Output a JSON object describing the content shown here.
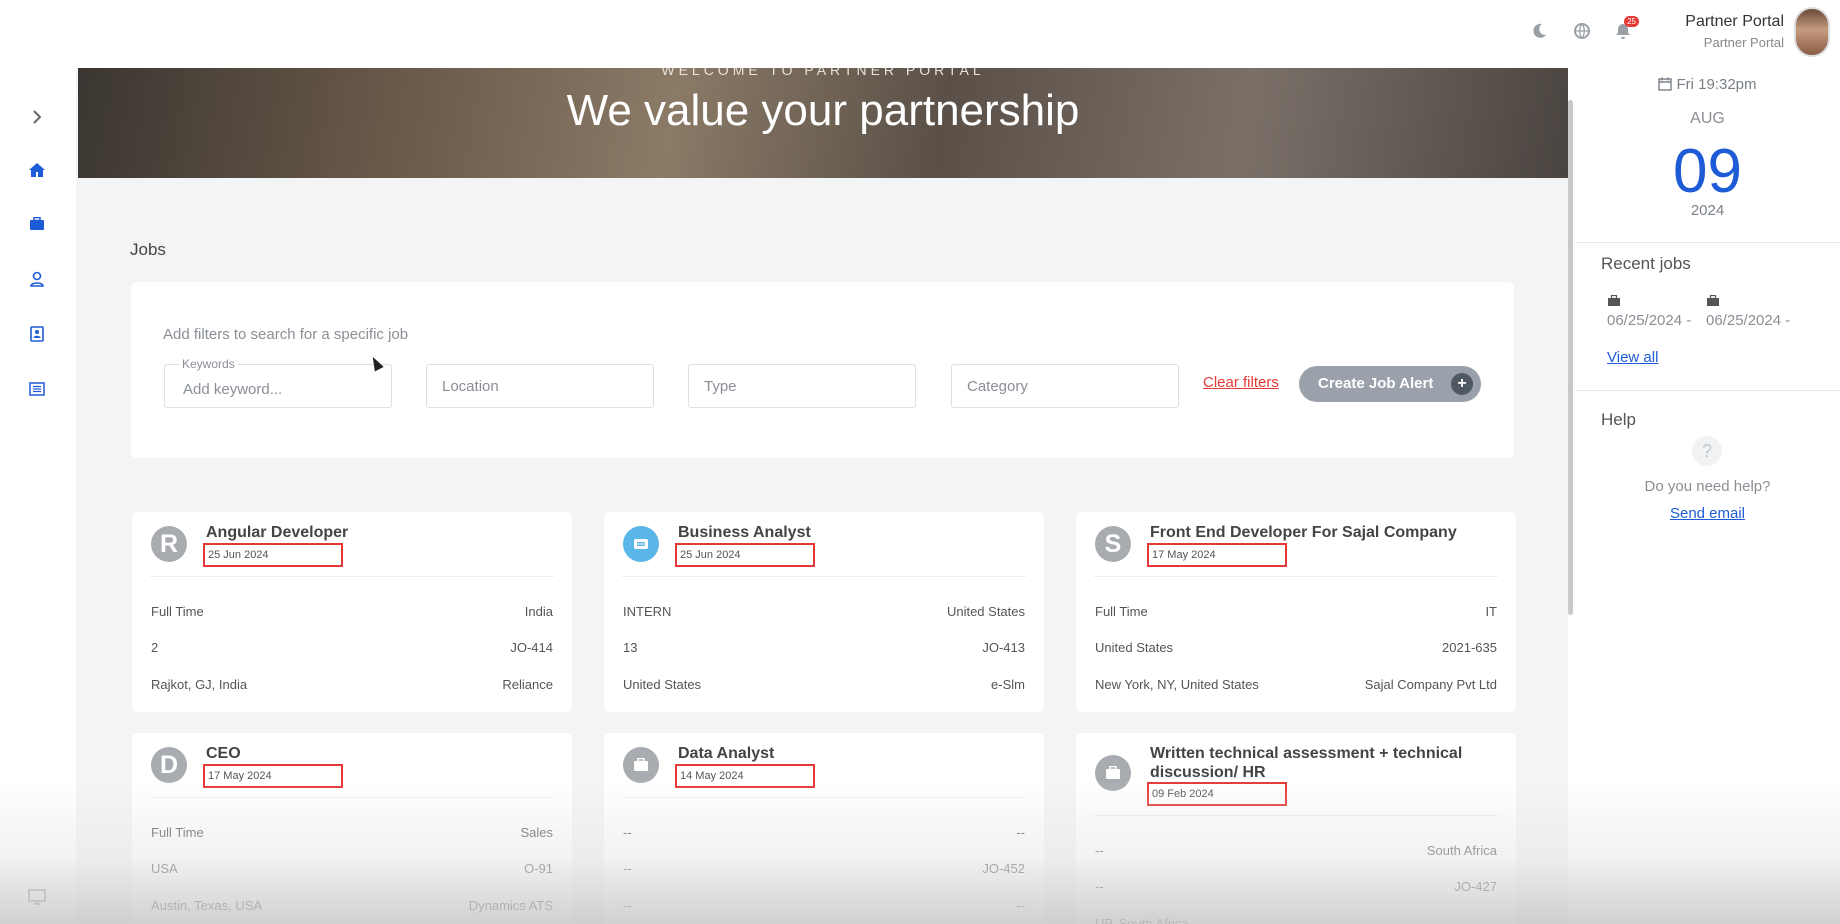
{
  "topbar": {
    "ghost_text": "",
    "notification_count": "25",
    "user_name": "Partner Portal",
    "user_role": "Partner Portal",
    "icons": [
      "moon-icon",
      "globe-icon",
      "bell-icon"
    ]
  },
  "sidebar": {
    "items": [
      "expand-chevron-icon",
      "home-icon",
      "briefcase-icon",
      "user-icon",
      "contacts-icon",
      "list-icon",
      "screen-share-icon"
    ]
  },
  "hero": {
    "subtitle": "WELCOME TO PARTNER PORTAL",
    "title": "We value your partnership"
  },
  "jobs": {
    "section_title": "Jobs",
    "filter_hint": "Add filters to search for a specific job",
    "keywords_label": "Keywords",
    "keywords_placeholder": "Add keyword...",
    "location_placeholder": "Location",
    "type_placeholder": "Type",
    "category_placeholder": "Category",
    "clear_filters": "Clear filters",
    "create_alert": "Create Job Alert",
    "create_alert_plus": "+"
  },
  "job_cards": [
    {
      "logo": "R",
      "title": "Angular Developer",
      "date": "25 Jun 2024",
      "rows": [
        [
          "Full Time",
          "India"
        ],
        [
          "2",
          "JO-414"
        ],
        [
          "Rajkot, GJ, India",
          "Reliance"
        ]
      ]
    },
    {
      "logo": "",
      "title": "Business Analyst",
      "date": "25 Jun 2024",
      "rows": [
        [
          "INTERN",
          "United States"
        ],
        [
          "13",
          "JO-413"
        ],
        [
          "United States",
          "e-Slm"
        ]
      ]
    },
    {
      "logo": "S",
      "title": "Front End Developer For Sajal Company",
      "date": "17 May 2024",
      "rows": [
        [
          "Full Time",
          "IT"
        ],
        [
          "United States",
          "2021-635"
        ],
        [
          "New York, NY, United States",
          "Sajal Company Pvt Ltd"
        ]
      ]
    },
    {
      "logo": "D",
      "title": "CEO",
      "date": "17 May 2024",
      "rows": [
        [
          "Full Time",
          "Sales"
        ],
        [
          "USA",
          "O-91"
        ],
        [
          "Austin, Texas, USA",
          "Dynamics ATS"
        ]
      ]
    },
    {
      "logo": "",
      "title": "Data Analyst",
      "date": "14 May 2024",
      "rows": [
        [
          "--",
          "--"
        ],
        [
          "--",
          "JO-452"
        ],
        [
          "--",
          "--"
        ]
      ]
    },
    {
      "logo": "",
      "title": "Written technical assessment + technical discussion/ HR",
      "date": "09 Feb 2024",
      "rows": [
        [
          "--",
          "South Africa"
        ],
        [
          "--",
          "JO-427"
        ],
        [
          "UP, South Africa",
          "--"
        ]
      ]
    }
  ],
  "right_panel": {
    "time": "Fri 19:32pm",
    "month": "AUG",
    "day": "09",
    "year": "2024",
    "recent_jobs_title": "Recent jobs",
    "recent_jobs": [
      "06/25/2024 -",
      "06/25/2024 -"
    ],
    "view_all": "View all",
    "help_title": "Help",
    "help_icon": "?",
    "help_text": "Do you need help?",
    "send_email": "Send email"
  },
  "colors": {
    "accent": "#1e5bd6",
    "highlight_box": "#e53935",
    "button_gray": "#9aa1aa",
    "background": "#f2f4f6"
  }
}
